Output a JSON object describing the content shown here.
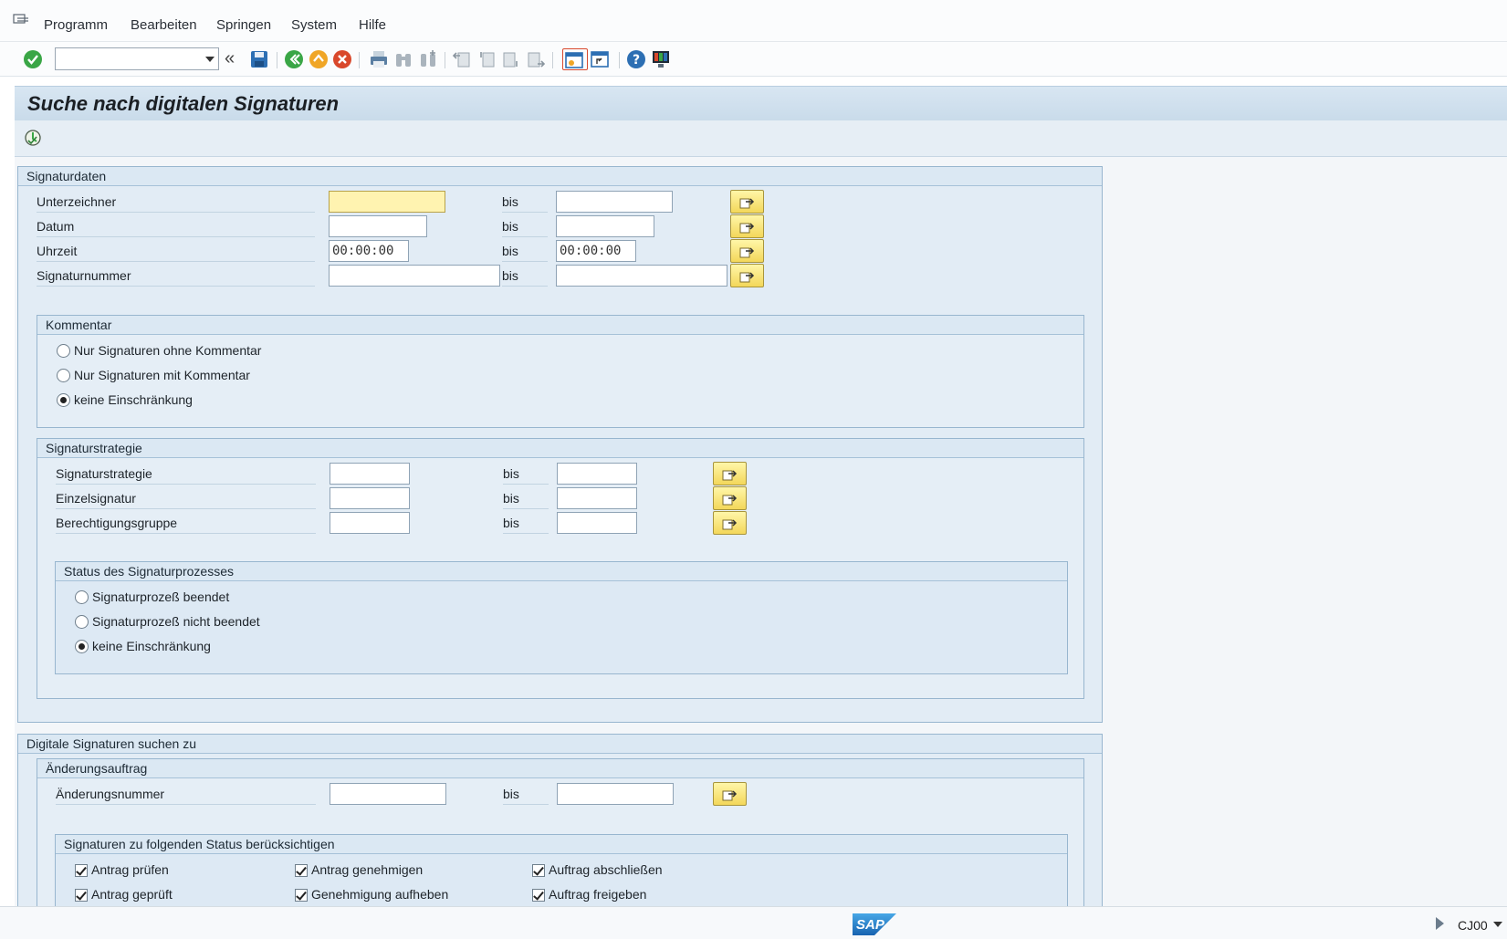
{
  "menu": {
    "items": [
      "Programm",
      "Bearbeiten",
      "Springen",
      "System",
      "Hilfe"
    ]
  },
  "toolbar": {
    "command_field_value": "",
    "icons": [
      "enter-check-icon",
      "history-back-icon",
      "save-icon",
      "back-icon",
      "exit-icon",
      "cancel-icon",
      "print-icon",
      "find-icon",
      "find-next-icon",
      "first-page-icon",
      "prev-page-icon",
      "next-page-icon",
      "last-page-icon",
      "new-session-icon",
      "shortcut-icon",
      "help-icon",
      "layout-icon"
    ]
  },
  "page": {
    "title": "Suche nach digitalen Signaturen"
  },
  "signaturdaten": {
    "title": "Signaturdaten",
    "rows": [
      {
        "label": "Unterzeichner",
        "from": "",
        "bis": "bis",
        "to": ""
      },
      {
        "label": "Datum",
        "from": "",
        "bis": "bis",
        "to": ""
      },
      {
        "label": "Uhrzeit",
        "from": "00:00:00",
        "bis": "bis",
        "to": "00:00:00"
      },
      {
        "label": "Signaturnummer",
        "from": "",
        "bis": "bis",
        "to": ""
      }
    ]
  },
  "kommentar": {
    "title": "Kommentar",
    "options": [
      "Nur Signaturen ohne Kommentar",
      "Nur Signaturen mit Kommentar",
      "keine Einschränkung"
    ],
    "selected_index": 2
  },
  "signaturstrategie": {
    "title": "Signaturstrategie",
    "rows": [
      {
        "label": "Signaturstrategie",
        "from": "",
        "bis": "bis",
        "to": ""
      },
      {
        "label": "Einzelsignatur",
        "from": "",
        "bis": "bis",
        "to": ""
      },
      {
        "label": "Berechtigungsgruppe",
        "from": "",
        "bis": "bis",
        "to": ""
      }
    ]
  },
  "status_prozess": {
    "title": "Status des Signaturprozesses",
    "options": [
      "Signaturprozeß beendet",
      "Signaturprozeß nicht beendet",
      "keine Einschränkung"
    ],
    "selected_index": 2
  },
  "digitale_suche": {
    "title": "Digitale Signaturen suchen zu"
  },
  "aenderungsauftrag": {
    "title": "Änderungsauftrag",
    "row": {
      "label": "Änderungsnummer",
      "from": "",
      "bis": "bis",
      "to": ""
    }
  },
  "status_checks": {
    "title": "Signaturen zu folgenden Status berücksichtigen",
    "items": [
      {
        "label": "Antrag prüfen",
        "checked": true
      },
      {
        "label": "Antrag genehmigen",
        "checked": true
      },
      {
        "label": "Auftrag abschließen",
        "checked": true
      },
      {
        "label": "Antrag geprüft",
        "checked": true
      },
      {
        "label": "Genehmigung aufheben",
        "checked": true
      },
      {
        "label": "Auftrag freigeben",
        "checked": true
      }
    ]
  },
  "statusbar": {
    "system": "CJ00",
    "logo": "SAP"
  },
  "colors": {
    "accent": "#4f8fc8",
    "frame": "#98b6cf",
    "focus_field": "#fff3b0"
  }
}
